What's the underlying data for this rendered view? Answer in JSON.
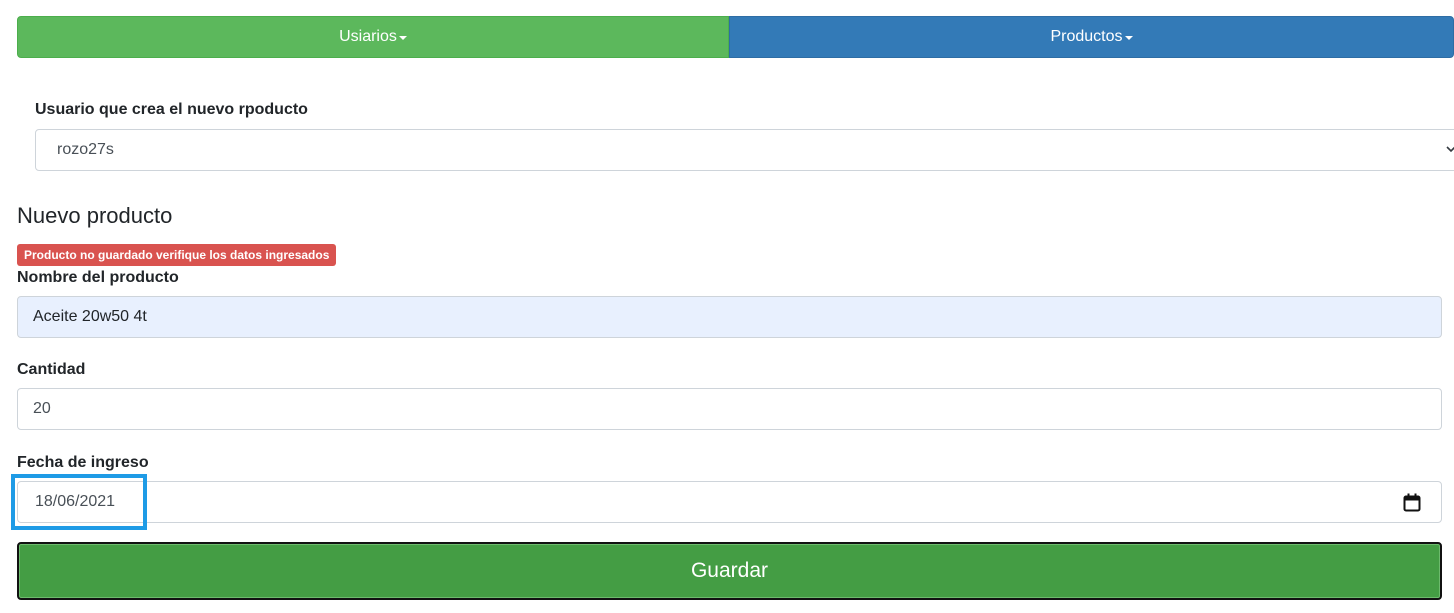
{
  "nav": {
    "users_label": "Usiarios",
    "products_label": "Productos"
  },
  "user_select": {
    "label": "Usuario que crea el nuevo rpoducto",
    "value": "rozo27s"
  },
  "form": {
    "title": "Nuevo producto",
    "error_badge": "Producto no guardado verifique los datos ingresados",
    "name_label": "Nombre del producto",
    "name_value": "Aceite 20w50 4t",
    "qty_label": "Cantidad",
    "qty_value": "20",
    "date_label": "Fecha de ingreso",
    "date_value": "18/06/2021",
    "save_label": "Guardar"
  },
  "colors": {
    "users_nav": "#5cb85c",
    "products_nav": "#337ab7",
    "error_badge": "#d9534f",
    "save_button": "#449d44",
    "focus_outline": "#1e9be6"
  },
  "icons": {
    "select_chevron": "chevron-down-icon",
    "date_picker": "calendar-icon"
  }
}
